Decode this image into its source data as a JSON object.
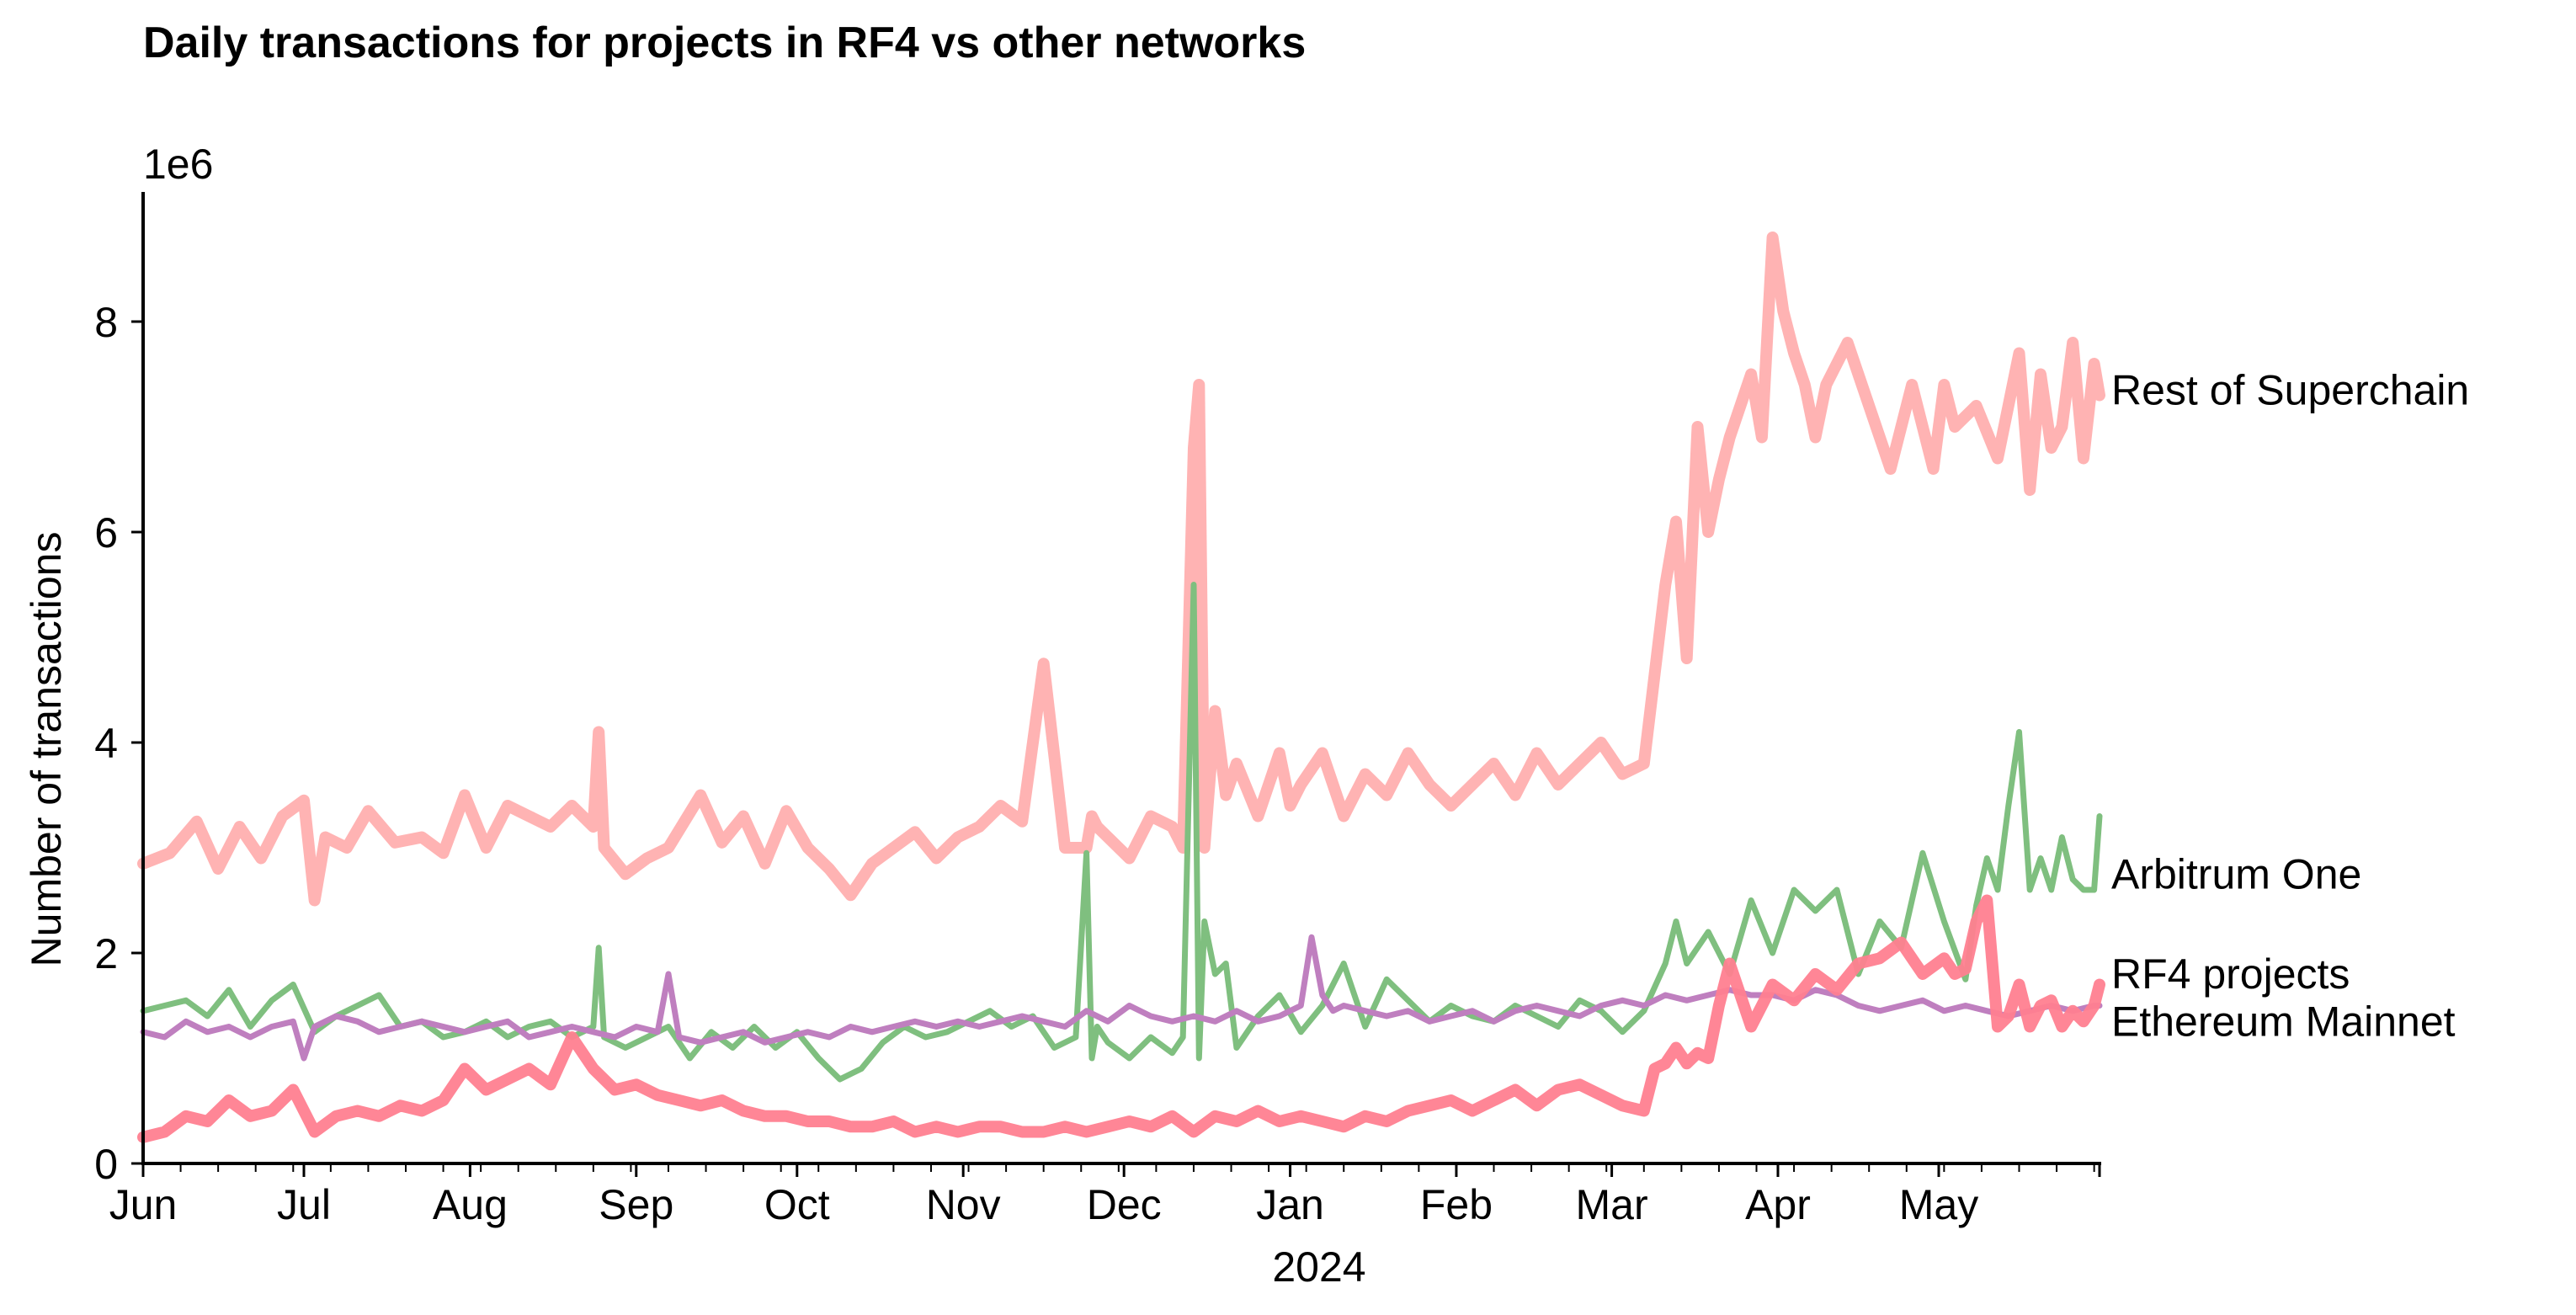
{
  "chart_data": {
    "type": "line",
    "title": "Daily transactions for projects in RF4 vs other networks",
    "xlabel": "2024",
    "ylabel": "Number of transactions",
    "y_offset_label": "1e6",
    "ylim": [
      0,
      9.2
    ],
    "yticks": [
      0,
      2,
      4,
      6,
      8
    ],
    "ytick_labels": [
      "0",
      "2",
      "4",
      "6",
      "8"
    ],
    "xlim_days": [
      0,
      365
    ],
    "x_start_date": "2023-06-01",
    "xticks": [
      {
        "label": "Jun",
        "day": 0
      },
      {
        "label": "Jul",
        "day": 30
      },
      {
        "label": "Aug",
        "day": 61
      },
      {
        "label": "Sep",
        "day": 92
      },
      {
        "label": "Oct",
        "day": 122
      },
      {
        "label": "Nov",
        "day": 153
      },
      {
        "label": "Dec",
        "day": 183
      },
      {
        "label": "Jan",
        "day": 214
      },
      {
        "label": "Feb",
        "day": 245
      },
      {
        "label": "Mar",
        "day": 274
      },
      {
        "label": "Apr",
        "day": 305
      },
      {
        "label": "May",
        "day": 335
      }
    ],
    "grid": false,
    "legend": "inline-right-end-labels",
    "series": [
      {
        "name": "Rest of Superchain",
        "color": "#ffb3b3",
        "days": [
          0,
          5,
          10,
          14,
          18,
          22,
          26,
          30,
          32,
          34,
          38,
          42,
          47,
          52,
          56,
          60,
          64,
          68,
          72,
          76,
          80,
          84,
          85,
          86,
          90,
          94,
          98,
          104,
          108,
          112,
          116,
          120,
          124,
          128,
          132,
          136,
          140,
          144,
          148,
          152,
          156,
          160,
          164,
          168,
          172,
          176,
          177,
          178,
          180,
          184,
          188,
          192,
          194,
          196,
          197,
          198,
          200,
          202,
          204,
          208,
          212,
          214,
          216,
          220,
          224,
          228,
          232,
          236,
          240,
          244,
          248,
          252,
          256,
          260,
          264,
          268,
          272,
          276,
          280,
          284,
          286,
          288,
          290,
          292,
          294,
          296,
          298,
          300,
          302,
          304,
          306,
          308,
          310,
          312,
          314,
          318,
          322,
          326,
          330,
          334,
          336,
          338,
          342,
          346,
          350,
          352,
          354,
          356,
          358,
          360,
          362,
          364,
          365
        ],
        "values": [
          2.85,
          2.95,
          3.25,
          2.8,
          3.2,
          2.9,
          3.3,
          3.45,
          2.5,
          3.1,
          3.0,
          3.35,
          3.05,
          3.1,
          2.95,
          3.5,
          3.0,
          3.4,
          3.3,
          3.2,
          3.4,
          3.2,
          4.1,
          3.0,
          2.75,
          2.9,
          3.0,
          3.5,
          3.05,
          3.3,
          2.85,
          3.35,
          3.0,
          2.8,
          2.55,
          2.85,
          3.0,
          3.15,
          2.9,
          3.1,
          3.2,
          3.4,
          3.25,
          4.75,
          3.0,
          3.0,
          3.3,
          3.2,
          3.1,
          2.9,
          3.3,
          3.2,
          3.0,
          6.8,
          7.4,
          3.0,
          4.3,
          3.5,
          3.8,
          3.3,
          3.9,
          3.4,
          3.6,
          3.9,
          3.3,
          3.7,
          3.5,
          3.9,
          3.6,
          3.4,
          3.6,
          3.8,
          3.5,
          3.9,
          3.6,
          3.8,
          4.0,
          3.7,
          3.8,
          5.5,
          6.1,
          4.8,
          7.0,
          6.0,
          6.5,
          6.9,
          7.2,
          7.5,
          6.9,
          8.8,
          8.1,
          7.7,
          7.4,
          6.9,
          7.4,
          7.8,
          7.2,
          6.6,
          7.4,
          6.6,
          7.4,
          7.0,
          7.2,
          6.7,
          7.7,
          6.4,
          7.5,
          6.8,
          7.0,
          7.8,
          6.7,
          7.6,
          7.3
        ]
      },
      {
        "name": "Arbitrum One",
        "color": "#7fbf7f",
        "days": [
          0,
          4,
          8,
          12,
          16,
          20,
          24,
          28,
          32,
          36,
          40,
          44,
          48,
          52,
          56,
          60,
          64,
          68,
          72,
          76,
          80,
          84,
          85,
          86,
          90,
          94,
          98,
          102,
          106,
          110,
          114,
          118,
          122,
          126,
          130,
          134,
          138,
          142,
          146,
          150,
          154,
          158,
          162,
          166,
          170,
          174,
          176,
          177,
          178,
          180,
          184,
          188,
          192,
          194,
          196,
          197,
          198,
          200,
          202,
          204,
          208,
          212,
          216,
          220,
          224,
          228,
          232,
          236,
          240,
          244,
          248,
          252,
          256,
          260,
          264,
          268,
          272,
          276,
          280,
          284,
          286,
          288,
          292,
          296,
          300,
          304,
          308,
          312,
          316,
          320,
          324,
          328,
          332,
          336,
          340,
          342,
          344,
          346,
          348,
          350,
          352,
          354,
          356,
          358,
          360,
          362,
          364,
          365
        ],
        "values": [
          1.45,
          1.5,
          1.55,
          1.4,
          1.65,
          1.3,
          1.55,
          1.7,
          1.25,
          1.4,
          1.5,
          1.6,
          1.3,
          1.35,
          1.2,
          1.25,
          1.35,
          1.2,
          1.3,
          1.35,
          1.2,
          1.3,
          2.05,
          1.2,
          1.1,
          1.2,
          1.3,
          1.0,
          1.25,
          1.1,
          1.3,
          1.1,
          1.25,
          1.0,
          0.8,
          0.9,
          1.15,
          1.3,
          1.2,
          1.25,
          1.35,
          1.45,
          1.3,
          1.4,
          1.1,
          1.2,
          2.95,
          1.0,
          1.3,
          1.15,
          1.0,
          1.2,
          1.05,
          1.2,
          5.5,
          1.0,
          2.3,
          1.8,
          1.9,
          1.1,
          1.4,
          1.6,
          1.25,
          1.5,
          1.9,
          1.3,
          1.75,
          1.55,
          1.35,
          1.5,
          1.4,
          1.35,
          1.5,
          1.4,
          1.3,
          1.55,
          1.45,
          1.25,
          1.45,
          1.9,
          2.3,
          1.9,
          2.2,
          1.8,
          2.5,
          2.0,
          2.6,
          2.4,
          2.6,
          1.8,
          2.3,
          2.05,
          2.95,
          2.3,
          1.75,
          2.45,
          2.9,
          2.6,
          3.4,
          4.1,
          2.6,
          2.9,
          2.6,
          3.1,
          2.7,
          2.6,
          2.6,
          3.3,
          2.7
        ]
      },
      {
        "name": "RF4 projects",
        "color": "#ff8090",
        "days": [
          0,
          4,
          8,
          12,
          16,
          20,
          24,
          28,
          32,
          36,
          40,
          44,
          48,
          52,
          56,
          60,
          64,
          68,
          72,
          76,
          80,
          84,
          88,
          92,
          96,
          100,
          104,
          108,
          112,
          116,
          120,
          124,
          128,
          132,
          136,
          140,
          144,
          148,
          152,
          156,
          160,
          164,
          168,
          172,
          176,
          180,
          184,
          188,
          192,
          196,
          200,
          204,
          208,
          212,
          216,
          220,
          224,
          228,
          232,
          236,
          240,
          244,
          248,
          252,
          256,
          260,
          264,
          268,
          272,
          276,
          280,
          282,
          284,
          286,
          288,
          290,
          292,
          294,
          296,
          298,
          300,
          302,
          304,
          308,
          312,
          316,
          320,
          324,
          328,
          332,
          336,
          338,
          340,
          342,
          344,
          346,
          348,
          350,
          352,
          354,
          356,
          358,
          360,
          362,
          364,
          365
        ],
        "values": [
          0.25,
          0.3,
          0.45,
          0.4,
          0.6,
          0.45,
          0.5,
          0.7,
          0.3,
          0.45,
          0.5,
          0.45,
          0.55,
          0.5,
          0.6,
          0.9,
          0.7,
          0.8,
          0.9,
          0.75,
          1.2,
          0.9,
          0.7,
          0.75,
          0.65,
          0.6,
          0.55,
          0.6,
          0.5,
          0.45,
          0.45,
          0.4,
          0.4,
          0.35,
          0.35,
          0.4,
          0.3,
          0.35,
          0.3,
          0.35,
          0.35,
          0.3,
          0.3,
          0.35,
          0.3,
          0.35,
          0.4,
          0.35,
          0.45,
          0.3,
          0.45,
          0.4,
          0.5,
          0.4,
          0.45,
          0.4,
          0.35,
          0.45,
          0.4,
          0.5,
          0.55,
          0.6,
          0.5,
          0.6,
          0.7,
          0.55,
          0.7,
          0.75,
          0.65,
          0.55,
          0.5,
          0.9,
          0.95,
          1.1,
          0.95,
          1.05,
          1.0,
          1.5,
          1.9,
          1.6,
          1.3,
          1.5,
          1.7,
          1.55,
          1.8,
          1.65,
          1.9,
          1.95,
          2.1,
          1.8,
          1.95,
          1.8,
          1.85,
          2.3,
          2.5,
          1.3,
          1.4,
          1.7,
          1.3,
          1.5,
          1.55,
          1.3,
          1.45,
          1.35,
          1.5,
          1.7,
          1.75
        ]
      },
      {
        "name": "Ethereum Mainnet",
        "color": "#bf7fbf",
        "days": [
          0,
          4,
          8,
          12,
          16,
          20,
          24,
          28,
          30,
          32,
          36,
          40,
          44,
          48,
          52,
          56,
          60,
          64,
          68,
          72,
          76,
          80,
          84,
          88,
          92,
          96,
          98,
          100,
          104,
          108,
          112,
          116,
          120,
          124,
          128,
          132,
          136,
          140,
          144,
          148,
          152,
          156,
          160,
          164,
          168,
          172,
          176,
          180,
          184,
          188,
          192,
          196,
          200,
          204,
          208,
          212,
          216,
          218,
          220,
          222,
          224,
          228,
          232,
          236,
          240,
          244,
          248,
          252,
          256,
          260,
          264,
          268,
          272,
          276,
          280,
          284,
          288,
          292,
          296,
          300,
          304,
          308,
          312,
          316,
          320,
          324,
          328,
          332,
          336,
          340,
          344,
          348,
          352,
          356,
          360,
          364,
          365
        ],
        "values": [
          1.25,
          1.2,
          1.35,
          1.25,
          1.3,
          1.2,
          1.3,
          1.35,
          1.0,
          1.3,
          1.4,
          1.35,
          1.25,
          1.3,
          1.35,
          1.3,
          1.25,
          1.3,
          1.35,
          1.2,
          1.25,
          1.3,
          1.25,
          1.2,
          1.3,
          1.25,
          1.8,
          1.2,
          1.15,
          1.2,
          1.25,
          1.15,
          1.2,
          1.25,
          1.2,
          1.3,
          1.25,
          1.3,
          1.35,
          1.3,
          1.35,
          1.3,
          1.35,
          1.4,
          1.35,
          1.3,
          1.45,
          1.35,
          1.5,
          1.4,
          1.35,
          1.4,
          1.35,
          1.45,
          1.35,
          1.4,
          1.5,
          2.15,
          1.6,
          1.45,
          1.5,
          1.45,
          1.4,
          1.45,
          1.35,
          1.4,
          1.45,
          1.35,
          1.45,
          1.5,
          1.45,
          1.4,
          1.5,
          1.55,
          1.5,
          1.6,
          1.55,
          1.6,
          1.65,
          1.6,
          1.6,
          1.55,
          1.65,
          1.6,
          1.5,
          1.45,
          1.5,
          1.55,
          1.45,
          1.5,
          1.45,
          1.4,
          1.45,
          1.5,
          1.45,
          1.5,
          1.5
        ]
      }
    ]
  }
}
